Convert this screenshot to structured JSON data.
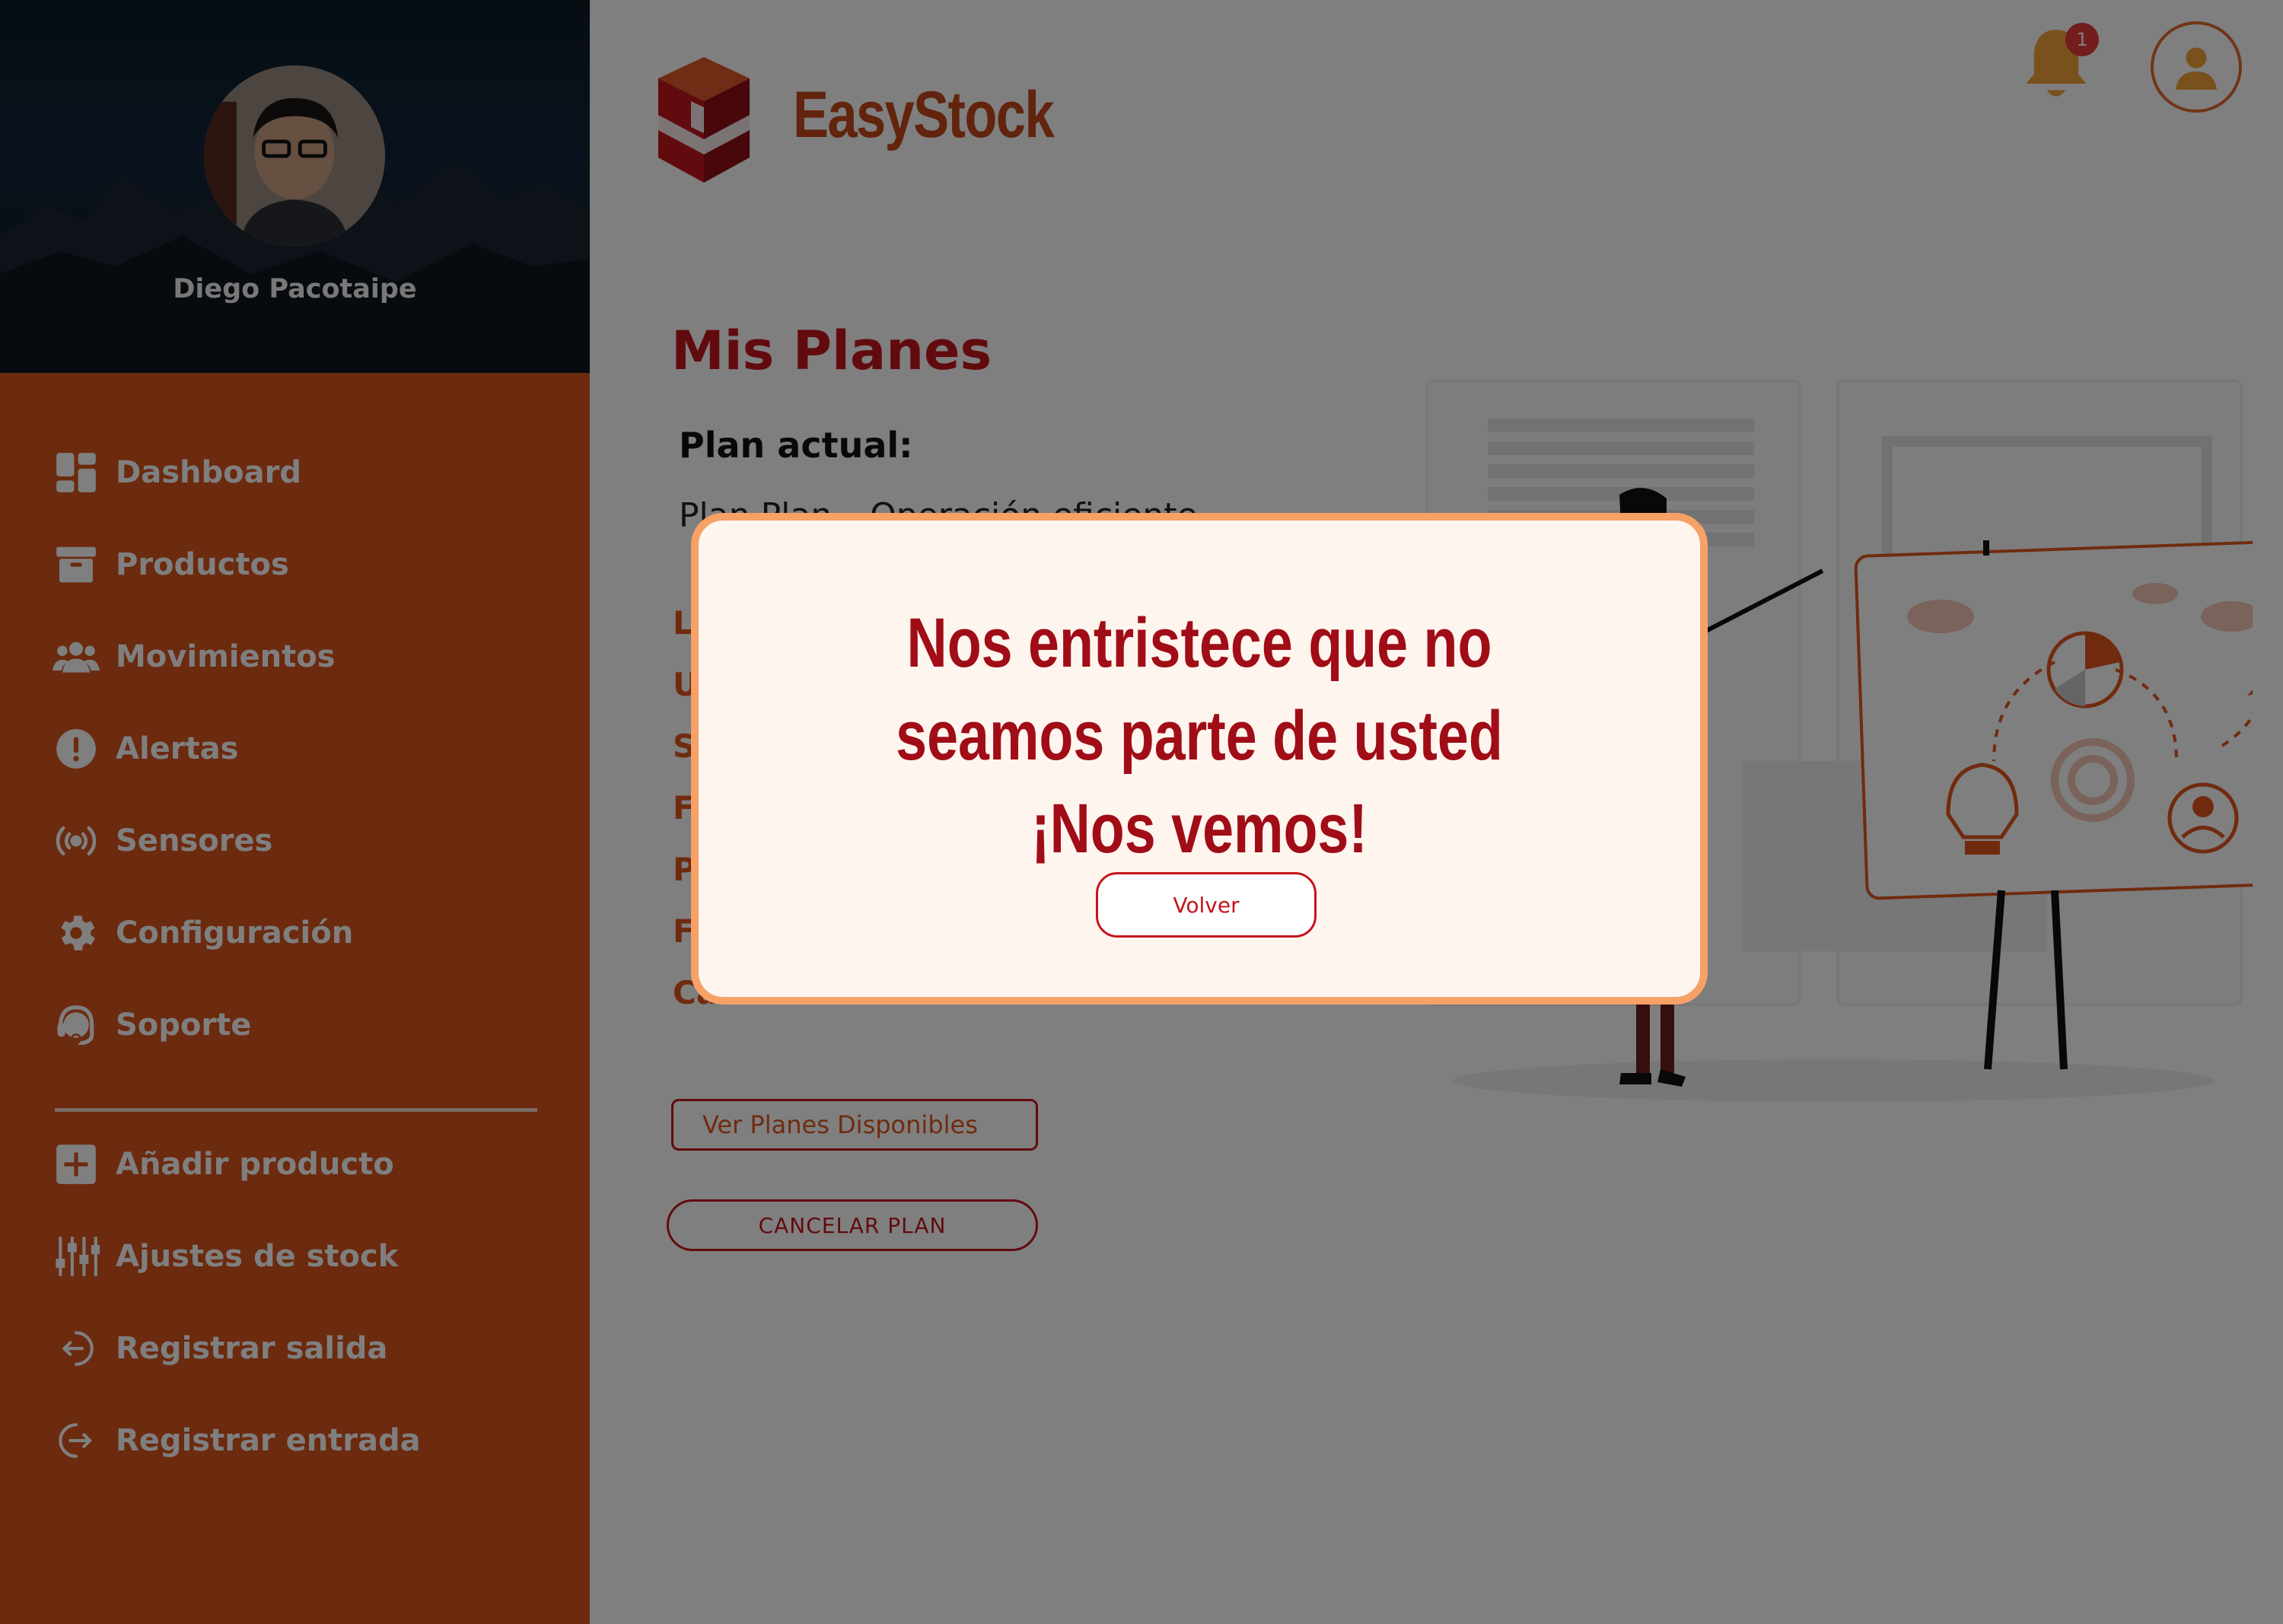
{
  "app": {
    "brand": "EasyStock"
  },
  "sidebar": {
    "user_name": "Diego Pacotaipe",
    "nav": [
      {
        "label": "Dashboard",
        "icon": "dashboard-icon"
      },
      {
        "label": "Productos",
        "icon": "archive-box-icon"
      },
      {
        "label": "Movimientos",
        "icon": "users-group-icon"
      },
      {
        "label": "Alertas",
        "icon": "alert-icon"
      },
      {
        "label": "Sensores",
        "icon": "sensor-broadcast-icon"
      },
      {
        "label": "Configuración",
        "icon": "gear-icon"
      },
      {
        "label": "Soporte",
        "icon": "headset-icon"
      }
    ],
    "actions": [
      {
        "label": "Añadir producto",
        "icon": "plus-square-icon"
      },
      {
        "label": "Ajustes de stock",
        "icon": "sliders-icon"
      },
      {
        "label": "Registrar salida",
        "icon": "logout-arrow-icon"
      },
      {
        "label": "Registrar entrada",
        "icon": "login-arrow-icon"
      }
    ]
  },
  "header": {
    "notifications_count": "1"
  },
  "main": {
    "title": "Mis Planes",
    "plan_label": "Plan actual:",
    "plan_value": "Plan Plan – Operación eficiente",
    "features_visible": [
      "L",
      "U",
      "S",
      "F",
      "P",
      "F",
      "Ca"
    ],
    "ver_planes_label": "Ver Planes Disponibles",
    "cancel_plan_label": "CANCELAR  PLAN"
  },
  "modal": {
    "message": "Nos entristece que no seamos parte de usted ¡Nos vemos!",
    "button_label": "Volver"
  },
  "colors": {
    "sidebar_bg": "#d9541e",
    "brand": "#c4481a",
    "title_red": "#c4161c",
    "modal_bg": "#fff5ef",
    "modal_border": "#f7a167",
    "modal_text": "#a00d17",
    "badge": "#e63a3a"
  }
}
